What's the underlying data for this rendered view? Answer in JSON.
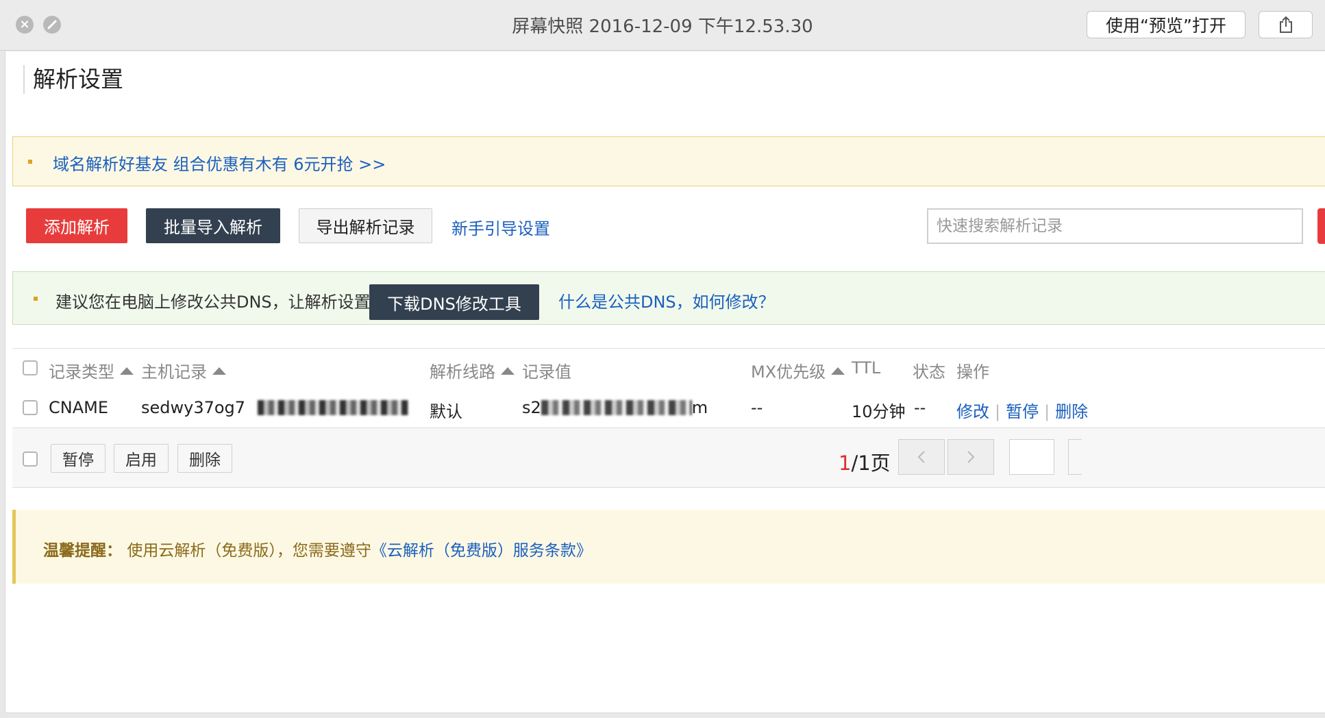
{
  "window": {
    "title": "屏幕快照 2016-12-09 下午12.53.30",
    "open_with_preview": "使用“预览”打开",
    "close_icon": "close-icon",
    "fullscreen_icon": "fullscreen-icon",
    "share_icon": "share-icon"
  },
  "page": {
    "title": "解析设置"
  },
  "promo": {
    "text": "域名解析好基友 组合优惠有木有 6元开抢 >>"
  },
  "toolbar": {
    "add_label": "添加解析",
    "batch_import_label": "批量导入解析",
    "export_label": "导出解析记录",
    "guide_link": "新手引导设置",
    "search_placeholder": "快速搜索解析记录"
  },
  "dns_tip": {
    "text": "建议您在电脑上修改公共DNS，让解析设置实时生效。",
    "download_button": "下载DNS修改工具",
    "help_link": "什么是公共DNS，如何修改？"
  },
  "table": {
    "headers": {
      "type": "记录类型",
      "host": "主机记录",
      "line": "解析线路",
      "value": "记录值",
      "mx": "MX优先级",
      "ttl": "TTL",
      "status": "状态",
      "actions": "操作"
    },
    "rows": [
      {
        "type": "CNAME",
        "host_visible": "sedwy37og7",
        "line": "默认",
        "value_prefix": "s2",
        "value_suffix": "m",
        "mx": "--",
        "ttl": "10分钟",
        "status": "--",
        "edit": "修改",
        "pause": "暂停",
        "delete": "删除",
        "separator": "|"
      }
    ]
  },
  "bulk": {
    "pause_label": "暂停",
    "enable_label": "启用",
    "delete_label": "删除"
  },
  "pager": {
    "current": "1",
    "rest": "/1页",
    "prev_icon": "chevron-left-icon",
    "next_icon": "chevron-right-icon"
  },
  "notice": {
    "label": "温馨提醒：",
    "text": "使用云解析（免费版），您需要遵守",
    "link": "《云解析（免费版）服务条款》"
  },
  "colors": {
    "primary_red": "#e83c3c",
    "dark_button": "#334050",
    "link_blue": "#1a5fbe"
  }
}
